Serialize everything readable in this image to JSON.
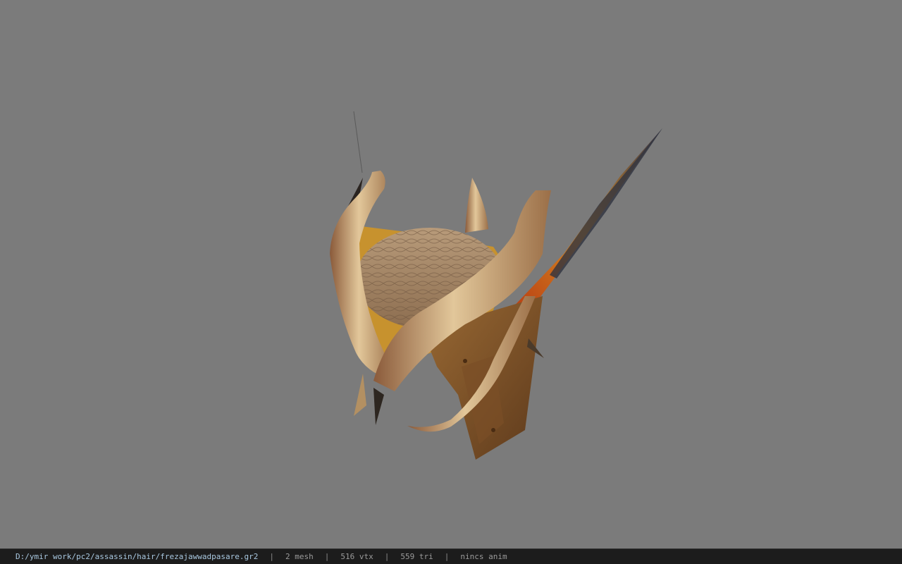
{
  "viewport": {
    "background_color": "#7b7b7b",
    "model_name": "hair model (3d preview)"
  },
  "statusbar": {
    "path": "D:/ymir work/pc2/assassin/hair/frezajawwadpasare.gr2",
    "separator": "|",
    "mesh": "2 mesh",
    "vtx": "516 vtx",
    "tri": "559 tri",
    "anim": "nincs anim"
  },
  "colors": {
    "status_bg": "#1c1c1c",
    "path_text": "#a9c8e0",
    "info_text": "#9a9a9a"
  }
}
